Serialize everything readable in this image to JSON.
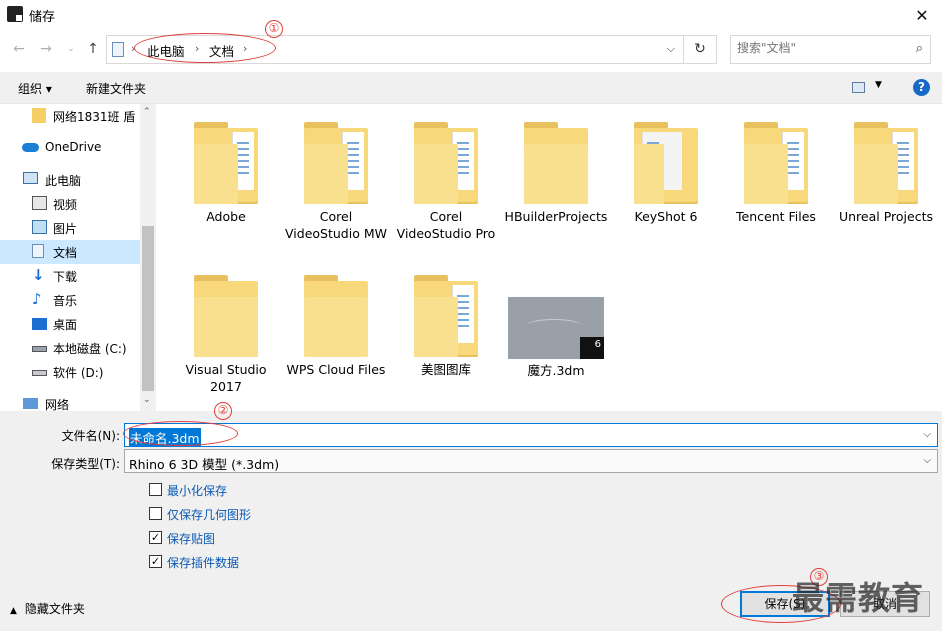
{
  "window": {
    "title": "储存"
  },
  "address": {
    "crumbs": [
      "此电脑",
      "文档"
    ]
  },
  "search": {
    "placeholder": "搜索\"文档\""
  },
  "toolbar": {
    "organize": "组织 ▾",
    "new_folder": "新建文件夹",
    "help": "?"
  },
  "sidebar": {
    "items": [
      {
        "label": "网络1831班   盾"
      },
      {
        "label": "OneDrive"
      },
      {
        "label": "此电脑"
      },
      {
        "label": "视频"
      },
      {
        "label": "图片"
      },
      {
        "label": "文档"
      },
      {
        "label": "下载"
      },
      {
        "label": "音乐"
      },
      {
        "label": "桌面"
      },
      {
        "label": "本地磁盘 (C:)"
      },
      {
        "label": "软件 (D:)"
      },
      {
        "label": "网络"
      }
    ]
  },
  "files": [
    {
      "label": "Adobe"
    },
    {
      "label": "Corel VideoStudio MW"
    },
    {
      "label": "Corel VideoStudio Pro"
    },
    {
      "label": "HBuilderProjects"
    },
    {
      "label": "KeyShot 6"
    },
    {
      "label": "Tencent Files"
    },
    {
      "label": "Unreal Projects"
    },
    {
      "label": "Visual Studio 2017"
    },
    {
      "label": "WPS Cloud Files"
    },
    {
      "label": "美图图库"
    },
    {
      "label": "魔方.3dm",
      "thumb_badge": "6"
    }
  ],
  "form": {
    "filename_label": "文件名(N):",
    "filename_value": "未命名.3dm",
    "filetype_label": "保存类型(T):",
    "filetype_value": "Rhino 6 3D 模型 (*.3dm)"
  },
  "options": [
    {
      "label": "最小化保存",
      "checked": false
    },
    {
      "label": "仅保存几何图形",
      "checked": false
    },
    {
      "label": "保存贴图",
      "checked": true
    },
    {
      "label": "保存插件数据",
      "checked": true
    }
  ],
  "footer": {
    "hide_folders": "隐藏文件夹",
    "save": "保存(S)",
    "cancel": "取消"
  },
  "annotations": [
    "①",
    "②",
    "③"
  ],
  "watermark": "最需教育"
}
